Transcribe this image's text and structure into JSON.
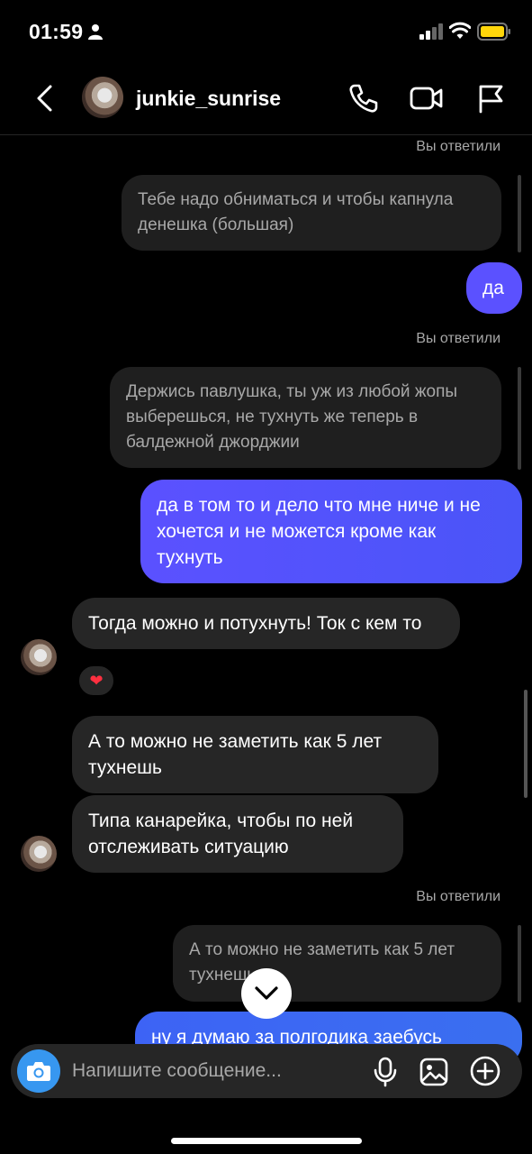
{
  "status_bar": {
    "time": "01:59"
  },
  "header": {
    "username": "junkie_sunrise"
  },
  "messages": {
    "replied_label": "Вы ответили",
    "quote1": "Тебе надо обниматься и чтобы капнула денешка (большая)",
    "out1": "да",
    "quote2": "Держись павлушка, ты уж из любой жопы выберешься, не тухнуть же теперь в балдежной джорджии",
    "out2": "да в том то и дело что мне ниче и не хочется и не можется кроме как тухнуть",
    "in1": "Тогда можно и потухнуть! Ток с кем то",
    "in1_reaction": "❤",
    "in2": "А то можно не заметить как 5 лет тухнешь",
    "in3": "Типа канарейка, чтобы по ней отслеживать ситуацию",
    "quote3": "А то можно не заметить как 5 лет тухнешь",
    "out3": "ну я думаю за полгодика заебусь"
  },
  "composer": {
    "placeholder": "Напишите сообщение..."
  },
  "colors": {
    "accent": "#3797f0",
    "bubble_out_start": "#5b51ff",
    "bubble_out_end": "#3b5cf5",
    "bubble_in": "#262626"
  }
}
